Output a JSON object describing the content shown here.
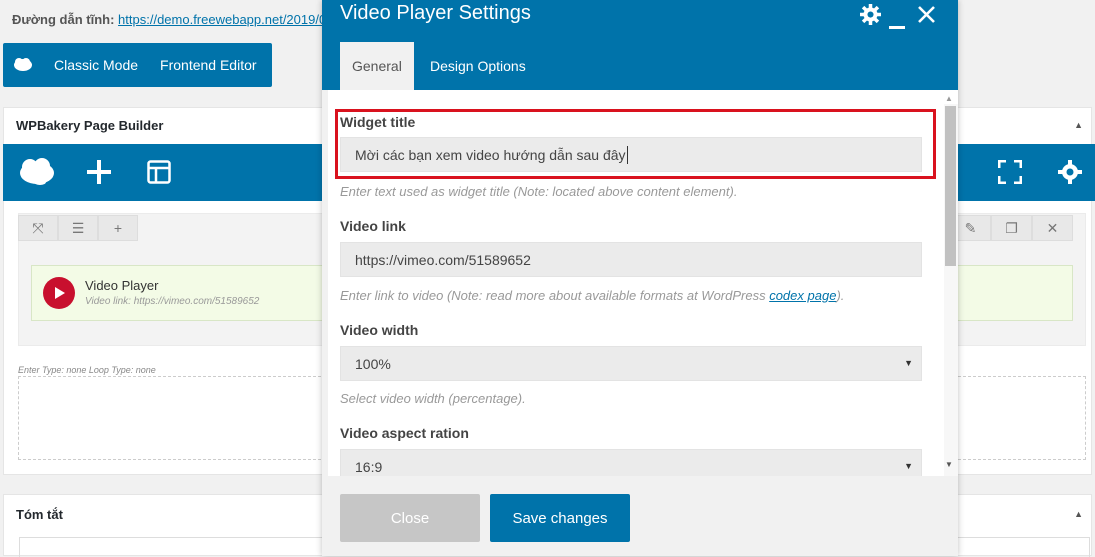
{
  "permalink": {
    "label": "Đường dẫn tĩnh:",
    "url": "https://demo.freewebapp.net/2019/0"
  },
  "mode_bar": {
    "classic_mode": "Classic Mode",
    "frontend_editor": "Frontend Editor"
  },
  "builder_panel": {
    "title": "WPBakery Page Builder",
    "element_title": "Video Player",
    "element_subtitle": "Video link: https://vimeo.com/51589652",
    "loop_note": "Enter Type: none  Loop Type: none"
  },
  "summary_panel": {
    "title": "Tóm tắt"
  },
  "modal": {
    "title": "Video Player Settings",
    "tabs": [
      {
        "label": "General",
        "active": true
      },
      {
        "label": "Design Options",
        "active": false
      }
    ],
    "fields": {
      "widget_title": {
        "label": "Widget title",
        "value": "Mời các bạn xem video hướng dẫn sau đây",
        "help": "Enter text used as widget title (Note: located above content element)."
      },
      "video_link": {
        "label": "Video link",
        "value": "https://vimeo.com/51589652",
        "help_prefix": "Enter link to video (Note: read more about available formats at WordPress ",
        "help_link": "codex page",
        "help_suffix": ")."
      },
      "video_width": {
        "label": "Video width",
        "value": "100%",
        "help": "Select video width (percentage)."
      },
      "aspect_ratio": {
        "label": "Video aspect ration",
        "value": "16:9"
      }
    },
    "footer": {
      "close": "Close",
      "save": "Save changes"
    }
  },
  "colors": {
    "primary": "#0073aa",
    "highlight": "#d9121e",
    "element_bg": "#f3fbe6",
    "play_icon": "#c8102e"
  }
}
